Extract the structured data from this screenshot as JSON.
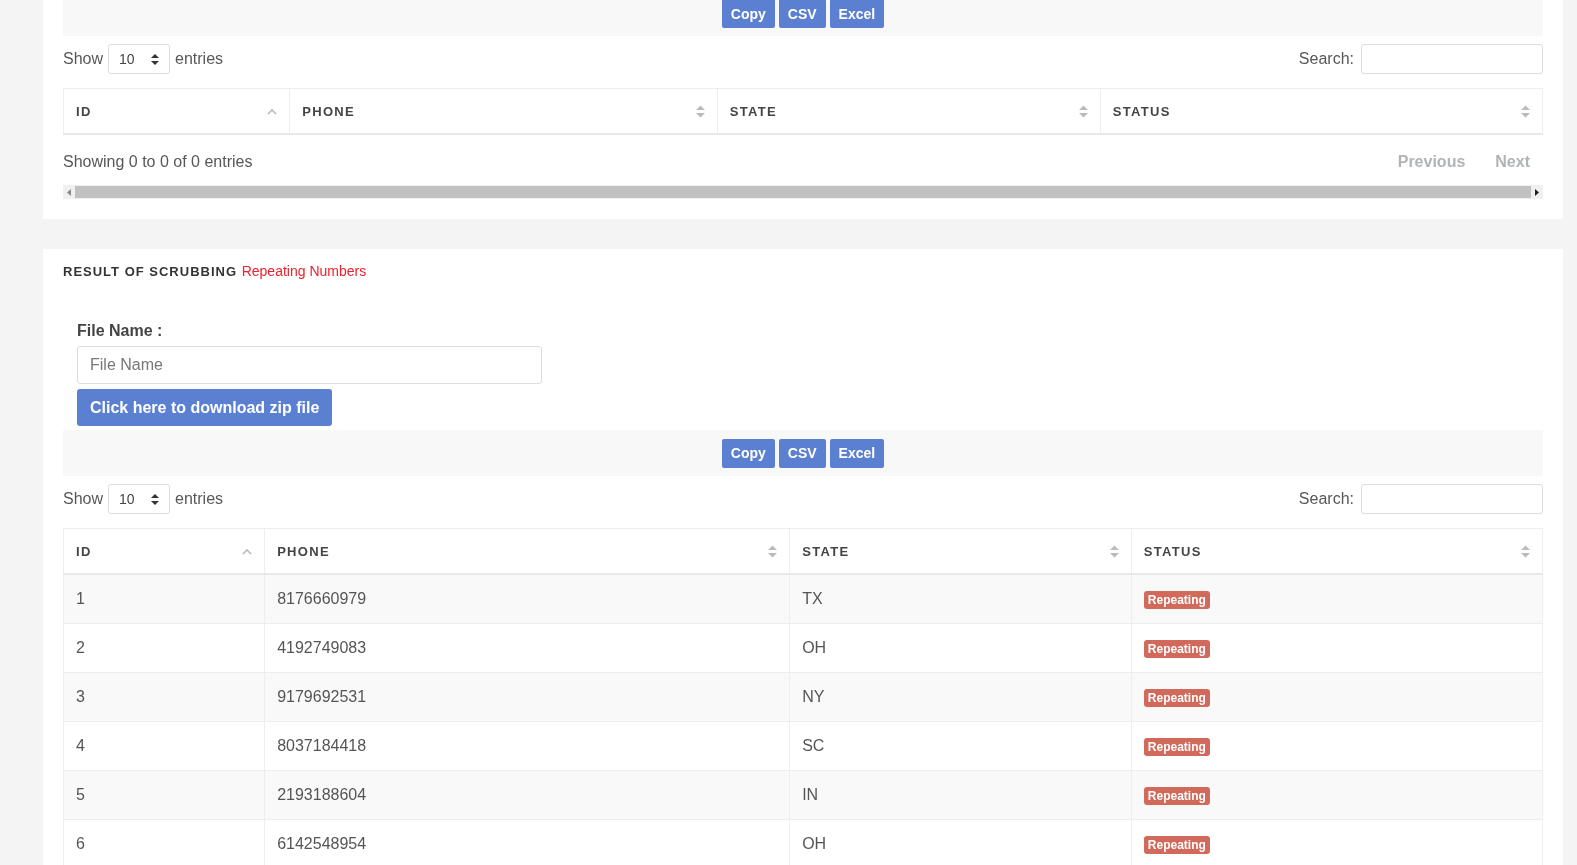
{
  "sections": [
    {
      "toolbar_buttons": [
        "Copy",
        "CSV",
        "Excel"
      ],
      "length": {
        "before": "Show",
        "value": "10",
        "after": "entries"
      },
      "search_label": "Search:",
      "columns": [
        {
          "label": "ID",
          "sorted": true
        },
        {
          "label": "PHONE",
          "sorted": false
        },
        {
          "label": "STATE",
          "sorted": false
        },
        {
          "label": "STATUS",
          "sorted": false
        }
      ],
      "info": "Showing 0 to 0 of 0 entries",
      "pagination": [
        {
          "label": "Previous",
          "disabled": true
        },
        {
          "label": "Next",
          "disabled": true
        }
      ]
    },
    {
      "title": "RESULT OF SCRUBBING",
      "subtitle": "Repeating Numbers",
      "file_label": "File Name :",
      "file_placeholder": "File Name",
      "download_button": "Click here to download zip file",
      "toolbar_buttons": [
        "Copy",
        "CSV",
        "Excel"
      ],
      "length": {
        "before": "Show",
        "value": "10",
        "after": "entries"
      },
      "search_label": "Search:",
      "columns": [
        {
          "label": "ID",
          "sorted": true
        },
        {
          "label": "PHONE",
          "sorted": false
        },
        {
          "label": "STATE",
          "sorted": false
        },
        {
          "label": "STATUS",
          "sorted": false
        }
      ],
      "rows": [
        {
          "id": "1",
          "phone": "8176660979",
          "state": "TX",
          "status": "Repeating"
        },
        {
          "id": "2",
          "phone": "4192749083",
          "state": "OH",
          "status": "Repeating"
        },
        {
          "id": "3",
          "phone": "9179692531",
          "state": "NY",
          "status": "Repeating"
        },
        {
          "id": "4",
          "phone": "8037184418",
          "state": "SC",
          "status": "Repeating"
        },
        {
          "id": "5",
          "phone": "2193188604",
          "state": "IN",
          "status": "Repeating"
        },
        {
          "id": "6",
          "phone": "6142548954",
          "state": "OH",
          "status": "Repeating"
        }
      ]
    }
  ]
}
